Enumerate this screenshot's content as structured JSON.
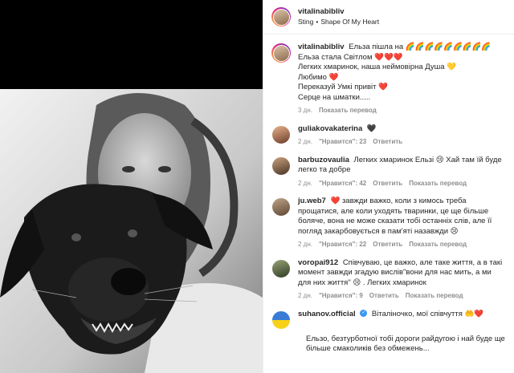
{
  "header": {
    "username": "vitalinabibliv",
    "artist": "Sting",
    "song": "Shape Of My Heart"
  },
  "caption": {
    "username": "vitalinabibliv",
    "lines": [
      "Ельза пішла на 🌈🌈🌈🌈🌈🌈🌈🌈🌈",
      "Ельза стала Світлом ❤️❤️❤️",
      "Легких хмаринок, наша неймовірна Душа 💛",
      "Любимо ❤️",
      "Переказуй Умкі привіт ❤️",
      "Серце на шматки....."
    ],
    "time": "3 дн.",
    "translate": "Показать перевод"
  },
  "comments": [
    {
      "username": "guliakovakaterina",
      "text": "🖤",
      "time": "2 дн.",
      "likes": "\"Нравится\": 23",
      "reply": "Ответить",
      "translate": ""
    },
    {
      "username": "barbuzovaulia",
      "text": "Легких хмаринок Ельзі 😢 Хай там їй буде легко та добре",
      "time": "2 дн.",
      "likes": "\"Нравится\": 42",
      "reply": "Ответить",
      "translate": "Показать перевод"
    },
    {
      "username": "ju.web7",
      "text": "❤️ завжди важко, коли з кимось треба прощатися, але коли уходять тваринки, це ще більше боляче, вона не може сказати тобі останніх слів, але її погляд закарбовується в пам'яті назавжди 😢",
      "time": "2 дн.",
      "likes": "\"Нравится\": 22",
      "reply": "Ответить",
      "translate": "Показать перевод"
    },
    {
      "username": "voropai912",
      "text": "Співчуваю, це важко, але таке життя, а в такі момент завжди згадую вислів\"вони для нас мить, а ми для них життя\" 😢 . Легких хмаринок",
      "time": "2 дн.",
      "likes": "\"Нравится\": 9",
      "reply": "Ответить",
      "translate": "Показать перевод"
    },
    {
      "username": "suhanov.official",
      "text": "Віталіночко, мої співчуття 🤲❤️",
      "more": "Ельзо, безтурботної тобі дороги райдугою і най буде ще більше смаколиків без обмежень..."
    }
  ]
}
